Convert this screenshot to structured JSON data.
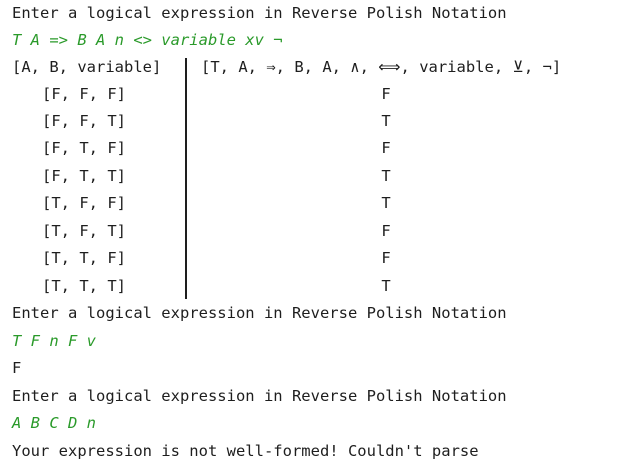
{
  "console": {
    "prompt_1": "Enter a logical expression in Reverse Polish Notation",
    "input_1": "T A => B A n <> variable xv ¬",
    "table": {
      "header_vars": "[A, B, variable]",
      "header_expr": "[T, A, ⇒, B, A, ∧, ⟺, variable, ⊻, ¬]",
      "rows": [
        {
          "inputs": "[F, F, F]",
          "result": "F"
        },
        {
          "inputs": "[F, F, T]",
          "result": "T"
        },
        {
          "inputs": "[F, T, F]",
          "result": "F"
        },
        {
          "inputs": "[F, T, T]",
          "result": "T"
        },
        {
          "inputs": "[T, F, F]",
          "result": "T"
        },
        {
          "inputs": "[T, F, T]",
          "result": "F"
        },
        {
          "inputs": "[T, T, F]",
          "result": "F"
        },
        {
          "inputs": "[T, T, T]",
          "result": "T"
        }
      ]
    },
    "prompt_2": "Enter a logical expression in Reverse Polish Notation",
    "input_2": "T F n F v",
    "output_2": "F",
    "prompt_3": "Enter a logical expression in Reverse Polish Notation",
    "input_3": "A B C D n",
    "output_3": "Your expression is not well-formed! Couldn't parse"
  },
  "colors": {
    "text": "#1e1e1e",
    "user_input": "#2a9a2a",
    "background": "#ffffff"
  }
}
